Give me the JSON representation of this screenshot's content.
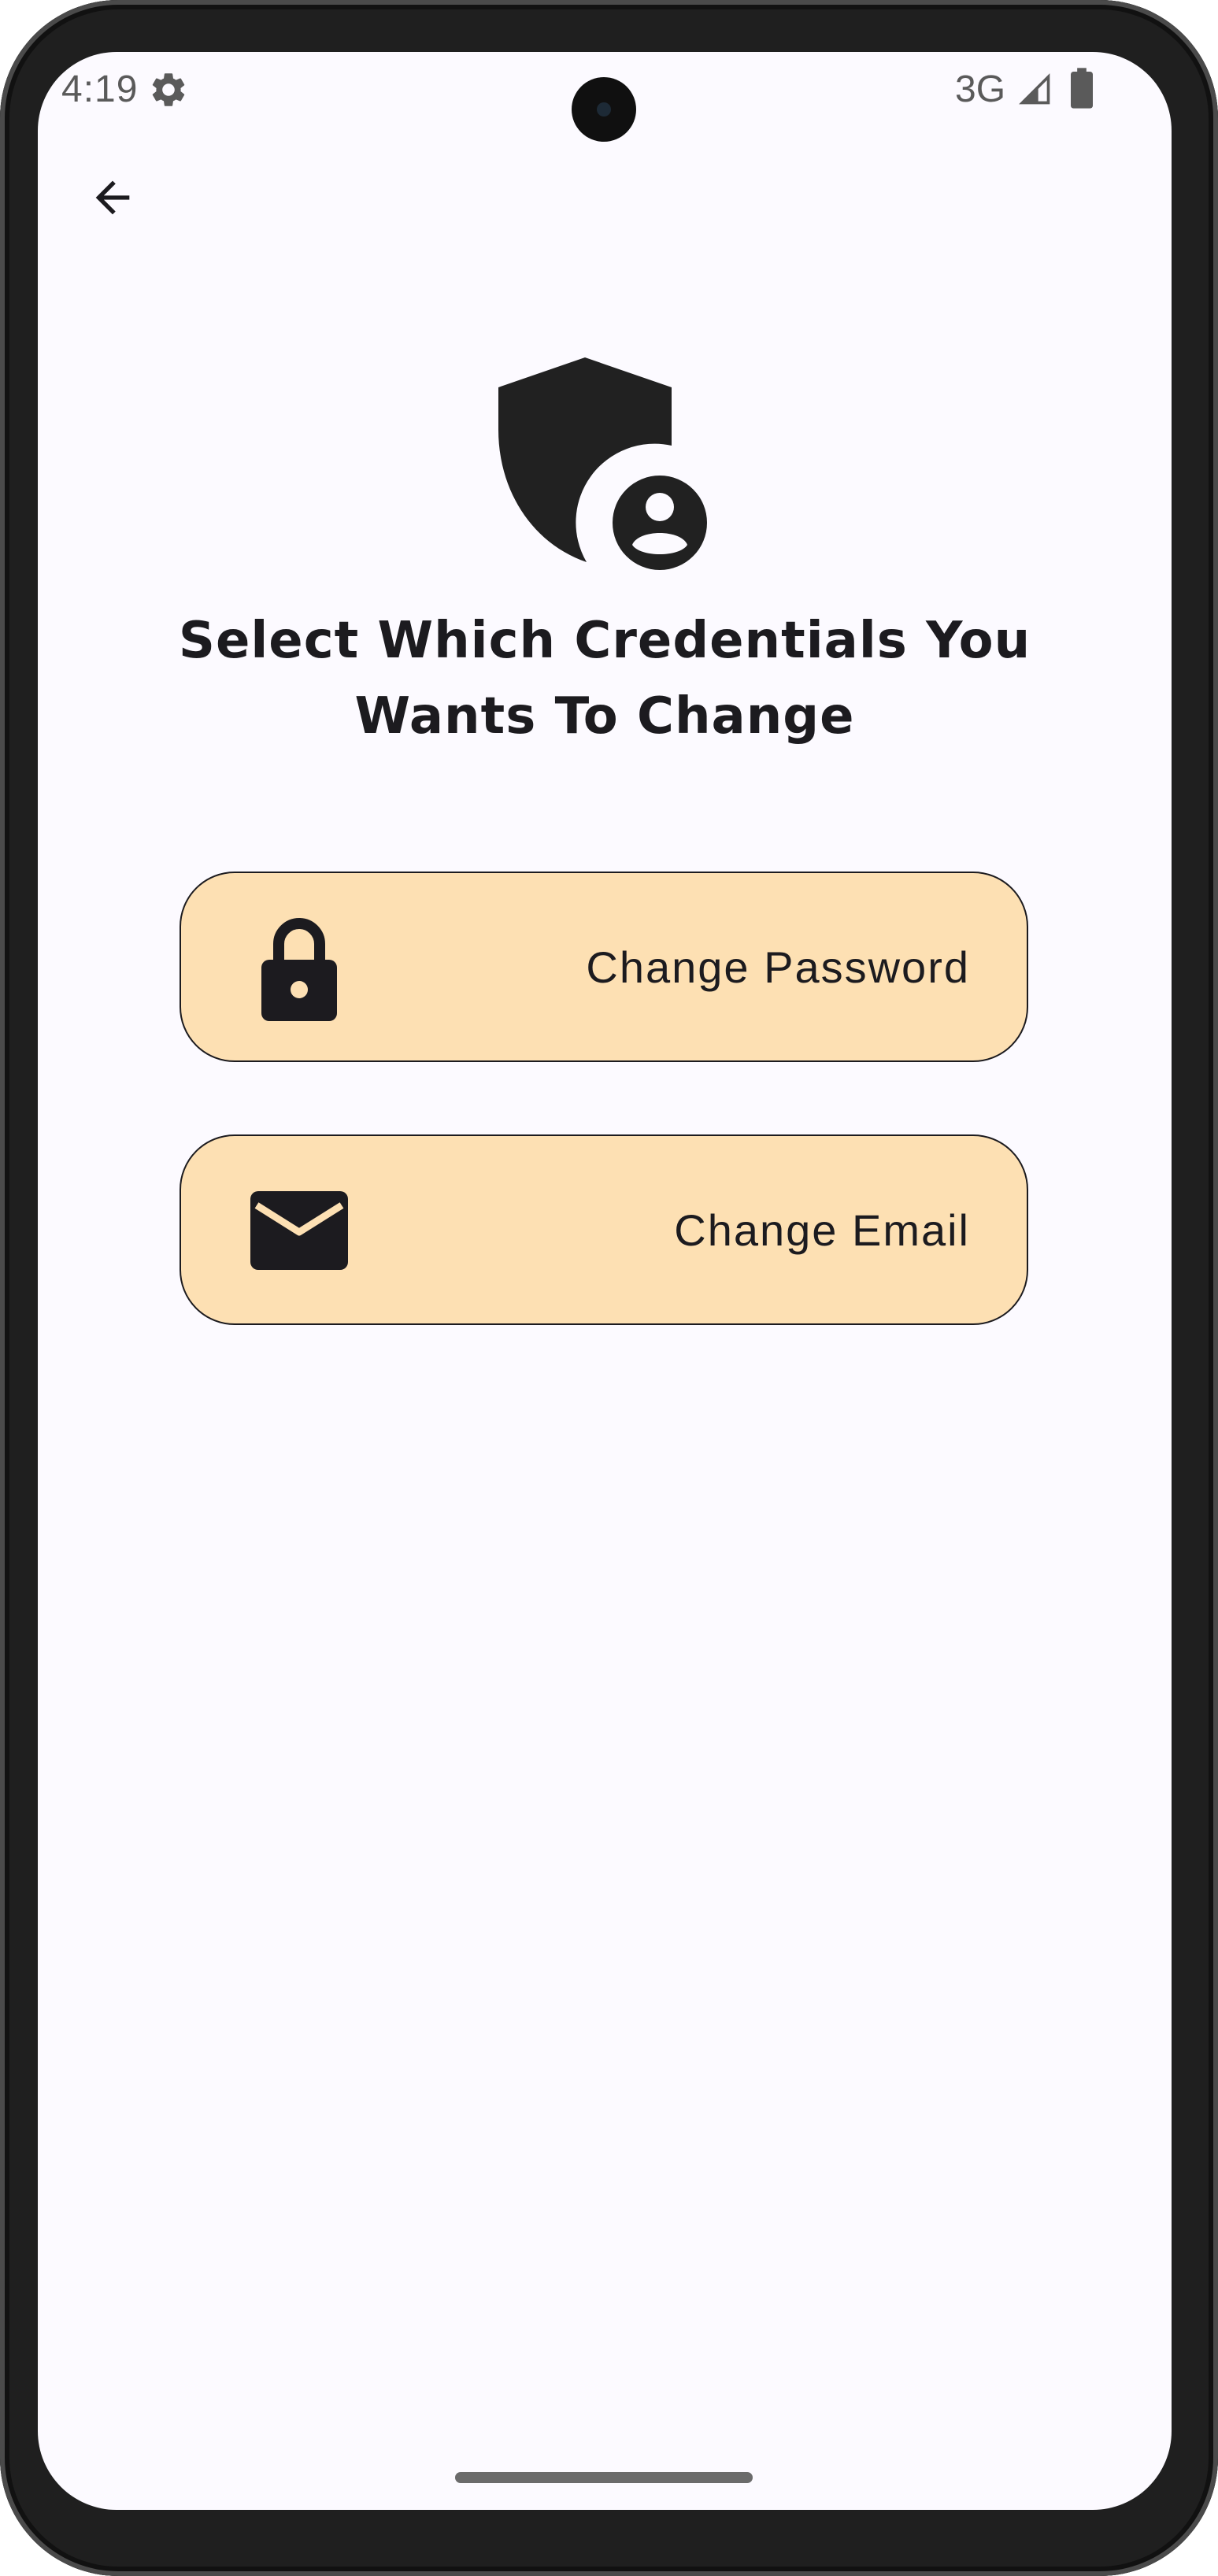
{
  "status_bar": {
    "time": "4:19",
    "network": "3G",
    "icons": [
      "gear-icon",
      "signal-icon",
      "battery-icon"
    ]
  },
  "header": {
    "back_icon": "arrow-left-icon"
  },
  "hero": {
    "icon": "shield-account-icon",
    "title": "Select Which Credentials You Wants To Change"
  },
  "options": [
    {
      "label": "Change Password",
      "icon": "lock-icon"
    },
    {
      "label": "Change Email",
      "icon": "email-icon"
    }
  ],
  "colors": {
    "background": "#fcfaff",
    "option_fill": "#fde0b3",
    "text": "#1c1b1f"
  }
}
